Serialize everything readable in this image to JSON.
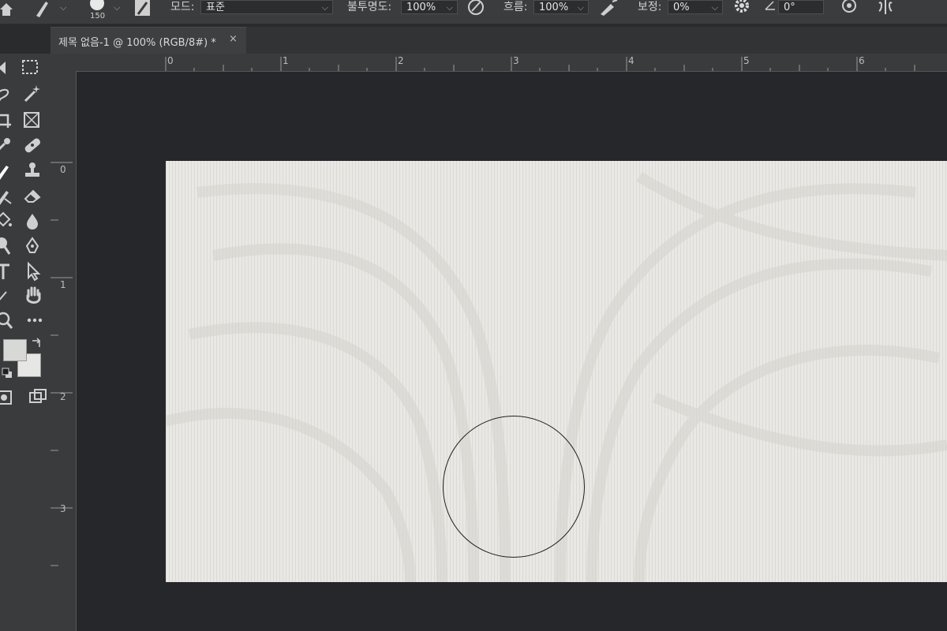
{
  "options_bar": {
    "brush_size": "150",
    "mode_label": "모드:",
    "mode_value": "표준",
    "opacity_label": "불투명도:",
    "opacity_value": "100%",
    "flow_label": "흐름:",
    "flow_value": "100%",
    "smoothing_label": "보정:",
    "smoothing_value": "0%",
    "angle_value": "0°"
  },
  "tab": {
    "title": "제목 없음-1 @ 100% (RGB/8#) *",
    "close": "×"
  },
  "rulers": {
    "top": [
      "0",
      "1",
      "2",
      "3",
      "4",
      "5",
      "6"
    ],
    "left": [
      "0",
      "1",
      "2",
      "3"
    ]
  },
  "colors": {
    "foreground": "#d8d8d6",
    "background": "#e6e6e4",
    "canvas": "#eae8e4"
  },
  "tools": [
    "move-icon",
    "marquee-icon",
    "lasso-icon",
    "magic-wand-icon",
    "crop-icon",
    "frame-icon",
    "eyedropper-icon",
    "healing-icon",
    "brush-icon",
    "stamp-icon",
    "history-brush-icon",
    "eraser-icon",
    "paint-bucket-icon",
    "blur-icon",
    "dodge-icon",
    "pen-icon",
    "type-icon",
    "path-select-icon",
    "line-icon",
    "hand-icon",
    "zoom-icon",
    "more-icon",
    "quick-mask-icon",
    "screen-mode-icon"
  ]
}
